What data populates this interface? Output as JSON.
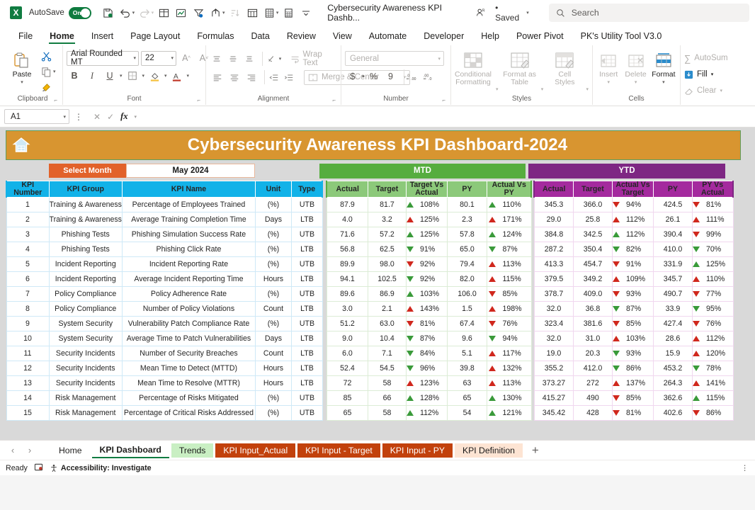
{
  "titlebar": {
    "autosave_label": "AutoSave",
    "autosave_state": "On",
    "doc_title": "Cybersecurity Awareness KPI Dashb...",
    "saved_status": "• Saved",
    "search_placeholder": "Search",
    "quick_access_icons": [
      "save-icon",
      "undo-icon",
      "redo-icon",
      "table-icon",
      "chart-icon",
      "filter-icon",
      "share-icon",
      "sort-icon",
      "pivot-icon",
      "sheet-icon",
      "calc-icon",
      "more-icon"
    ]
  },
  "ribbon": {
    "tabs": [
      "File",
      "Home",
      "Insert",
      "Page Layout",
      "Formulas",
      "Data",
      "Review",
      "View",
      "Automate",
      "Developer",
      "Help",
      "Power Pivot",
      "PK's Utility Tool V3.0"
    ],
    "active_tab": "Home",
    "groups": {
      "clipboard": {
        "label": "Clipboard",
        "paste": "Paste",
        "cut_icon": "scissors-icon",
        "copy_icon": "copy-icon",
        "format_painter_icon": "format-painter-icon"
      },
      "font": {
        "label": "Font",
        "font_family": "Arial Rounded MT",
        "font_size": "22",
        "bold": "B",
        "italic": "I",
        "underline": "U",
        "grow_icon": "increase-font-size-icon",
        "shrink_icon": "decrease-font-size-icon",
        "borders_icon": "borders-icon",
        "fill_icon": "fill-color-icon",
        "font_color_icon": "font-color-icon"
      },
      "alignment": {
        "label": "Alignment",
        "wrap_text": "Wrap Text",
        "merge_center": "Merge & Center",
        "orientation_icon": "text-orientation-icon",
        "indent_icons": [
          "decrease-indent-icon",
          "increase-indent-icon"
        ]
      },
      "number": {
        "label": "Number",
        "format": "General",
        "currency": "$",
        "percent": "%",
        "comma": "9",
        "inc_decimal_icon": "increase-decimal-icon",
        "dec_decimal_icon": "decrease-decimal-icon"
      },
      "styles": {
        "label": "Styles",
        "conditional_formatting": "Conditional Formatting",
        "format_as_table": "Format as Table",
        "cell_styles": "Cell Styles"
      },
      "cells": {
        "label": "Cells",
        "insert": "Insert",
        "delete": "Delete",
        "format": "Format"
      },
      "editing": {
        "autosum": "AutoSum",
        "fill": "Fill",
        "clear": "Clear"
      }
    }
  },
  "formula_bar": {
    "name_box": "A1",
    "cancel_icon": "cancel-icon",
    "enter_icon": "confirm-icon",
    "fx_icon": "fx-icon",
    "formula_value": ""
  },
  "dashboard": {
    "home_icon": "home-icon",
    "title": "Cybersecurity Awareness KPI Dashboard-2024",
    "select_month_label": "Select Month",
    "selected_month": "May 2024",
    "bands": {
      "mtd": "MTD",
      "ytd": "YTD"
    },
    "headers_left": [
      "KPI Number",
      "KPI Group",
      "KPI Name",
      "Unit",
      "Type"
    ],
    "headers_mtd": [
      "Actual",
      "Target",
      "Target Vs Actual",
      "PY",
      "Actual Vs PY"
    ],
    "headers_ytd": [
      "Actual",
      "Target",
      "Actual Vs Target",
      "PY",
      "PY Vs Actual"
    ],
    "colors": {
      "banner": "#d89530",
      "left_header": "#12b2e8",
      "mtd_band": "#56ad3f",
      "mtd_header": "#8cc97a",
      "ytd_band": "#7e2783",
      "ytd_header": "#a42a9e",
      "select_month": "#e2622a",
      "up_red": "#d0271d",
      "up_green": "#3a9a3a"
    },
    "rows": [
      {
        "n": "1",
        "group": "Training & Awareness",
        "name": "Percentage of Employees Trained",
        "unit": "(%)",
        "type": "UTB",
        "mtd": {
          "actual": "87.9",
          "target": "81.7",
          "tva": {
            "dir": "up",
            "color": "green",
            "val": "108%"
          },
          "py": "80.1",
          "avp": {
            "dir": "up",
            "color": "green",
            "val": "110%"
          }
        },
        "ytd": {
          "actual": "345.3",
          "target": "366.0",
          "avt": {
            "dir": "down",
            "color": "red",
            "val": "94%"
          },
          "py": "424.5",
          "pva": {
            "dir": "down",
            "color": "red",
            "val": "81%"
          }
        }
      },
      {
        "n": "2",
        "group": "Training & Awareness",
        "name": "Average Training Completion Time",
        "unit": "Days",
        "type": "LTB",
        "mtd": {
          "actual": "4.0",
          "target": "3.2",
          "tva": {
            "dir": "up",
            "color": "red",
            "val": "125%"
          },
          "py": "2.3",
          "avp": {
            "dir": "up",
            "color": "red",
            "val": "171%"
          }
        },
        "ytd": {
          "actual": "29.0",
          "target": "25.8",
          "avt": {
            "dir": "up",
            "color": "red",
            "val": "112%"
          },
          "py": "26.1",
          "pva": {
            "dir": "up",
            "color": "red",
            "val": "111%"
          }
        }
      },
      {
        "n": "3",
        "group": "Phishing Tests",
        "name": "Phishing Simulation Success Rate",
        "unit": "(%)",
        "type": "UTB",
        "mtd": {
          "actual": "71.6",
          "target": "57.2",
          "tva": {
            "dir": "up",
            "color": "green",
            "val": "125%"
          },
          "py": "57.8",
          "avp": {
            "dir": "up",
            "color": "green",
            "val": "124%"
          }
        },
        "ytd": {
          "actual": "384.8",
          "target": "342.5",
          "avt": {
            "dir": "up",
            "color": "green",
            "val": "112%"
          },
          "py": "390.4",
          "pva": {
            "dir": "down",
            "color": "red",
            "val": "99%"
          }
        }
      },
      {
        "n": "4",
        "group": "Phishing Tests",
        "name": "Phishing Click Rate",
        "unit": "(%)",
        "type": "LTB",
        "mtd": {
          "actual": "56.8",
          "target": "62.5",
          "tva": {
            "dir": "down",
            "color": "green",
            "val": "91%"
          },
          "py": "65.0",
          "avp": {
            "dir": "down",
            "color": "green",
            "val": "87%"
          }
        },
        "ytd": {
          "actual": "287.2",
          "target": "350.4",
          "avt": {
            "dir": "down",
            "color": "green",
            "val": "82%"
          },
          "py": "410.0",
          "pva": {
            "dir": "down",
            "color": "green",
            "val": "70%"
          }
        }
      },
      {
        "n": "5",
        "group": "Incident Reporting",
        "name": "Incident Reporting Rate",
        "unit": "(%)",
        "type": "UTB",
        "mtd": {
          "actual": "89.9",
          "target": "98.0",
          "tva": {
            "dir": "down",
            "color": "red",
            "val": "92%"
          },
          "py": "79.4",
          "avp": {
            "dir": "up",
            "color": "red",
            "val": "113%"
          }
        },
        "ytd": {
          "actual": "413.3",
          "target": "454.7",
          "avt": {
            "dir": "down",
            "color": "red",
            "val": "91%"
          },
          "py": "331.9",
          "pva": {
            "dir": "up",
            "color": "green",
            "val": "125%"
          }
        }
      },
      {
        "n": "6",
        "group": "Incident Reporting",
        "name": "Average Incident Reporting Time",
        "unit": "Hours",
        "type": "LTB",
        "mtd": {
          "actual": "94.1",
          "target": "102.5",
          "tva": {
            "dir": "down",
            "color": "green",
            "val": "92%"
          },
          "py": "82.0",
          "avp": {
            "dir": "up",
            "color": "red",
            "val": "115%"
          }
        },
        "ytd": {
          "actual": "379.5",
          "target": "349.2",
          "avt": {
            "dir": "up",
            "color": "red",
            "val": "109%"
          },
          "py": "345.7",
          "pva": {
            "dir": "up",
            "color": "red",
            "val": "110%"
          }
        }
      },
      {
        "n": "7",
        "group": "Policy Compliance",
        "name": "Policy Adherence Rate",
        "unit": "(%)",
        "type": "UTB",
        "mtd": {
          "actual": "89.6",
          "target": "86.9",
          "tva": {
            "dir": "up",
            "color": "green",
            "val": "103%"
          },
          "py": "106.0",
          "avp": {
            "dir": "down",
            "color": "red",
            "val": "85%"
          }
        },
        "ytd": {
          "actual": "378.7",
          "target": "409.0",
          "avt": {
            "dir": "down",
            "color": "red",
            "val": "93%"
          },
          "py": "490.7",
          "pva": {
            "dir": "down",
            "color": "red",
            "val": "77%"
          }
        }
      },
      {
        "n": "8",
        "group": "Policy Compliance",
        "name": "Number of Policy Violations",
        "unit": "Count",
        "type": "LTB",
        "mtd": {
          "actual": "3.0",
          "target": "2.1",
          "tva": {
            "dir": "up",
            "color": "red",
            "val": "143%"
          },
          "py": "1.5",
          "avp": {
            "dir": "up",
            "color": "red",
            "val": "198%"
          }
        },
        "ytd": {
          "actual": "32.0",
          "target": "36.8",
          "avt": {
            "dir": "down",
            "color": "green",
            "val": "87%"
          },
          "py": "33.9",
          "pva": {
            "dir": "down",
            "color": "green",
            "val": "95%"
          }
        }
      },
      {
        "n": "9",
        "group": "System Security",
        "name": "Vulnerability Patch Compliance Rate",
        "unit": "(%)",
        "type": "UTB",
        "mtd": {
          "actual": "51.2",
          "target": "63.0",
          "tva": {
            "dir": "down",
            "color": "red",
            "val": "81%"
          },
          "py": "67.4",
          "avp": {
            "dir": "down",
            "color": "red",
            "val": "76%"
          }
        },
        "ytd": {
          "actual": "323.4",
          "target": "381.6",
          "avt": {
            "dir": "down",
            "color": "red",
            "val": "85%"
          },
          "py": "427.4",
          "pva": {
            "dir": "down",
            "color": "red",
            "val": "76%"
          }
        }
      },
      {
        "n": "10",
        "group": "System Security",
        "name": "Average Time to Patch Vulnerabilities",
        "unit": "Days",
        "type": "LTB",
        "mtd": {
          "actual": "9.0",
          "target": "10.4",
          "tva": {
            "dir": "down",
            "color": "green",
            "val": "87%"
          },
          "py": "9.6",
          "avp": {
            "dir": "down",
            "color": "green",
            "val": "94%"
          }
        },
        "ytd": {
          "actual": "32.0",
          "target": "31.0",
          "avt": {
            "dir": "up",
            "color": "red",
            "val": "103%"
          },
          "py": "28.6",
          "pva": {
            "dir": "up",
            "color": "red",
            "val": "112%"
          }
        }
      },
      {
        "n": "11",
        "group": "Security Incidents",
        "name": "Number of Security Breaches",
        "unit": "Count",
        "type": "LTB",
        "mtd": {
          "actual": "6.0",
          "target": "7.1",
          "tva": {
            "dir": "down",
            "color": "green",
            "val": "84%"
          },
          "py": "5.1",
          "avp": {
            "dir": "up",
            "color": "red",
            "val": "117%"
          }
        },
        "ytd": {
          "actual": "19.0",
          "target": "20.3",
          "avt": {
            "dir": "down",
            "color": "green",
            "val": "93%"
          },
          "py": "15.9",
          "pva": {
            "dir": "up",
            "color": "red",
            "val": "120%"
          }
        }
      },
      {
        "n": "12",
        "group": "Security Incidents",
        "name": "Mean Time to Detect (MTTD)",
        "unit": "Hours",
        "type": "LTB",
        "mtd": {
          "actual": "52.4",
          "target": "54.5",
          "tva": {
            "dir": "down",
            "color": "green",
            "val": "96%"
          },
          "py": "39.8",
          "avp": {
            "dir": "up",
            "color": "red",
            "val": "132%"
          }
        },
        "ytd": {
          "actual": "355.2",
          "target": "412.0",
          "avt": {
            "dir": "down",
            "color": "green",
            "val": "86%"
          },
          "py": "453.2",
          "pva": {
            "dir": "down",
            "color": "green",
            "val": "78%"
          }
        }
      },
      {
        "n": "13",
        "group": "Security Incidents",
        "name": "Mean Time to Resolve (MTTR)",
        "unit": "Hours",
        "type": "LTB",
        "mtd": {
          "actual": "72",
          "target": "58",
          "tva": {
            "dir": "up",
            "color": "red",
            "val": "123%"
          },
          "py": "63",
          "avp": {
            "dir": "up",
            "color": "red",
            "val": "113%"
          }
        },
        "ytd": {
          "actual": "373.27",
          "target": "272",
          "avt": {
            "dir": "up",
            "color": "red",
            "val": "137%"
          },
          "py": "264.3",
          "pva": {
            "dir": "up",
            "color": "red",
            "val": "141%"
          }
        }
      },
      {
        "n": "14",
        "group": "Risk Management",
        "name": "Percentage of Risks Mitigated",
        "unit": "(%)",
        "type": "UTB",
        "mtd": {
          "actual": "85",
          "target": "66",
          "tva": {
            "dir": "up",
            "color": "green",
            "val": "128%"
          },
          "py": "65",
          "avp": {
            "dir": "up",
            "color": "green",
            "val": "130%"
          }
        },
        "ytd": {
          "actual": "415.27",
          "target": "490",
          "avt": {
            "dir": "down",
            "color": "red",
            "val": "85%"
          },
          "py": "362.6",
          "pva": {
            "dir": "up",
            "color": "green",
            "val": "115%"
          }
        }
      },
      {
        "n": "15",
        "group": "Risk Management",
        "name": "Percentage of Critical Risks Addressed",
        "unit": "(%)",
        "type": "UTB",
        "mtd": {
          "actual": "65",
          "target": "58",
          "tva": {
            "dir": "up",
            "color": "green",
            "val": "112%"
          },
          "py": "54",
          "avp": {
            "dir": "up",
            "color": "green",
            "val": "121%"
          }
        },
        "ytd": {
          "actual": "345.42",
          "target": "428",
          "avt": {
            "dir": "down",
            "color": "red",
            "val": "81%"
          },
          "py": "402.6",
          "pva": {
            "dir": "down",
            "color": "red",
            "val": "86%"
          }
        }
      }
    ]
  },
  "sheet_tabs": {
    "prev_icon": "previous-sheet-icon",
    "next_icon": "next-sheet-icon",
    "add_label": "+",
    "items": [
      {
        "label": "Home",
        "style": "plain",
        "selected": false
      },
      {
        "label": "KPI Dashboard",
        "style": "plain",
        "selected": true
      },
      {
        "label": "Trends",
        "style": "green",
        "selected": false
      },
      {
        "label": "KPI Input_Actual",
        "style": "orange",
        "selected": false
      },
      {
        "label": "KPI Input - Target",
        "style": "orange",
        "selected": false
      },
      {
        "label": "KPI Input - PY",
        "style": "orange",
        "selected": false
      },
      {
        "label": "KPI Definition",
        "style": "peach",
        "selected": false
      }
    ]
  },
  "status_bar": {
    "state": "Ready",
    "recording_icon": "macro-record-icon",
    "accessibility": "Accessibility: Investigate",
    "options_icon": "more-options-icon"
  }
}
